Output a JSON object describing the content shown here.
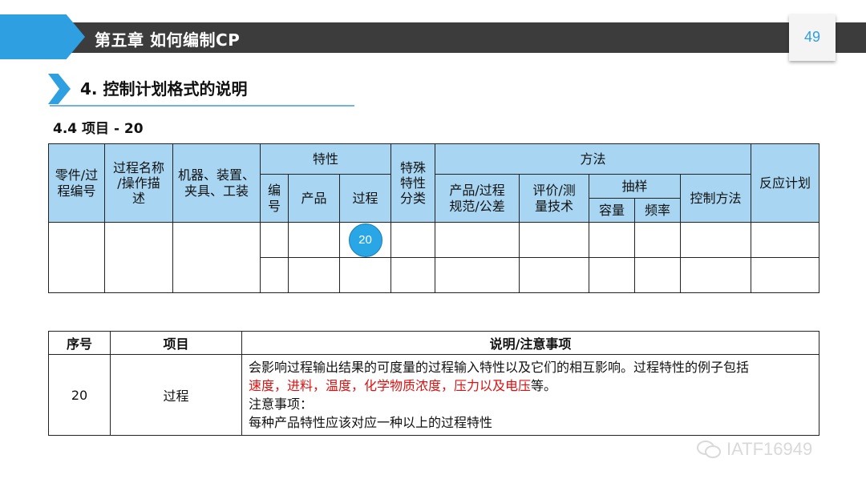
{
  "header": {
    "chapter_title": "第五章  如何编制CP",
    "page_number": "49"
  },
  "section": {
    "title": "4. 控制计划格式的说明",
    "item_title": "4.4 项目 - 20"
  },
  "cp_table": {
    "part_process_no": [
      "零件/过",
      "程编号"
    ],
    "process_name": [
      "过程名称",
      "/操作描",
      "述"
    ],
    "machine": [
      "机器、装置、",
      "夹具、工装"
    ],
    "characteristics": "特性",
    "char_no": [
      "编",
      "号"
    ],
    "char_product": "产品",
    "char_process": "过程",
    "special_char": [
      "特殊",
      "特性",
      "分类"
    ],
    "methods": "方法",
    "spec": [
      "产品/过程",
      "规范/公差"
    ],
    "measurement": [
      "评价/测",
      "量技术"
    ],
    "sampling": "抽样",
    "size": "容量",
    "frequency": "频率",
    "control_method": "控制方法",
    "reaction_plan": "反应计划",
    "badge": "20"
  },
  "note_table": {
    "headers": [
      "序号",
      "项目",
      "说明/注意事项"
    ],
    "row": {
      "no": "20",
      "item": "过程",
      "line1": "会影响过程输出结果的可度量的过程输入特性以及它们的相互影响。过程特性的例子包括",
      "line2_red": "速度，进料，温度，化学物质浓度，压力以及电压",
      "line2_end": "等。",
      "line3": "注意事项：",
      "line4": "每种产品特性应该对应一种以上的过程特性"
    }
  },
  "watermark": {
    "text": "IATF16949",
    "icon": "wechat-icon"
  },
  "colors": {
    "accent": "#2e9fe0",
    "header_fill": "#a8d6f2",
    "bar": "#3c3c3c",
    "highlight": "#e01010"
  }
}
